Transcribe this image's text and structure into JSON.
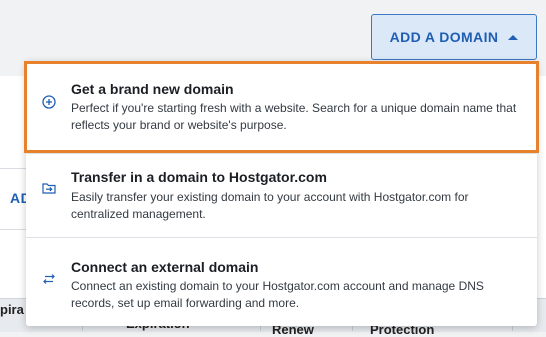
{
  "header": {
    "add_domain_label": "ADD A DOMAIN"
  },
  "background": {
    "tab_label_partial": "AD",
    "table_headers": [
      "pira",
      "Expiration",
      "Renew",
      "Protection"
    ]
  },
  "dropdown": {
    "items": [
      {
        "title": "Get a brand new domain",
        "description": "Perfect if you're starting fresh with a website. Search for a unique domain name that reflects your brand or website's purpose.",
        "icon": "plus-circle-icon"
      },
      {
        "title": "Transfer in a domain to Hostgator.com",
        "description": "Easily transfer your existing domain to your account with Hostgator.com for centralized management.",
        "icon": "folder-transfer-icon"
      },
      {
        "title": "Connect an external domain",
        "description": "Connect an existing domain to your Hostgator.com account and manage DNS records, set up email forwarding and more.",
        "icon": "arrows-swap-icon"
      }
    ]
  },
  "colors": {
    "accent": "#1f5eb3",
    "highlight": "#e8812c"
  }
}
